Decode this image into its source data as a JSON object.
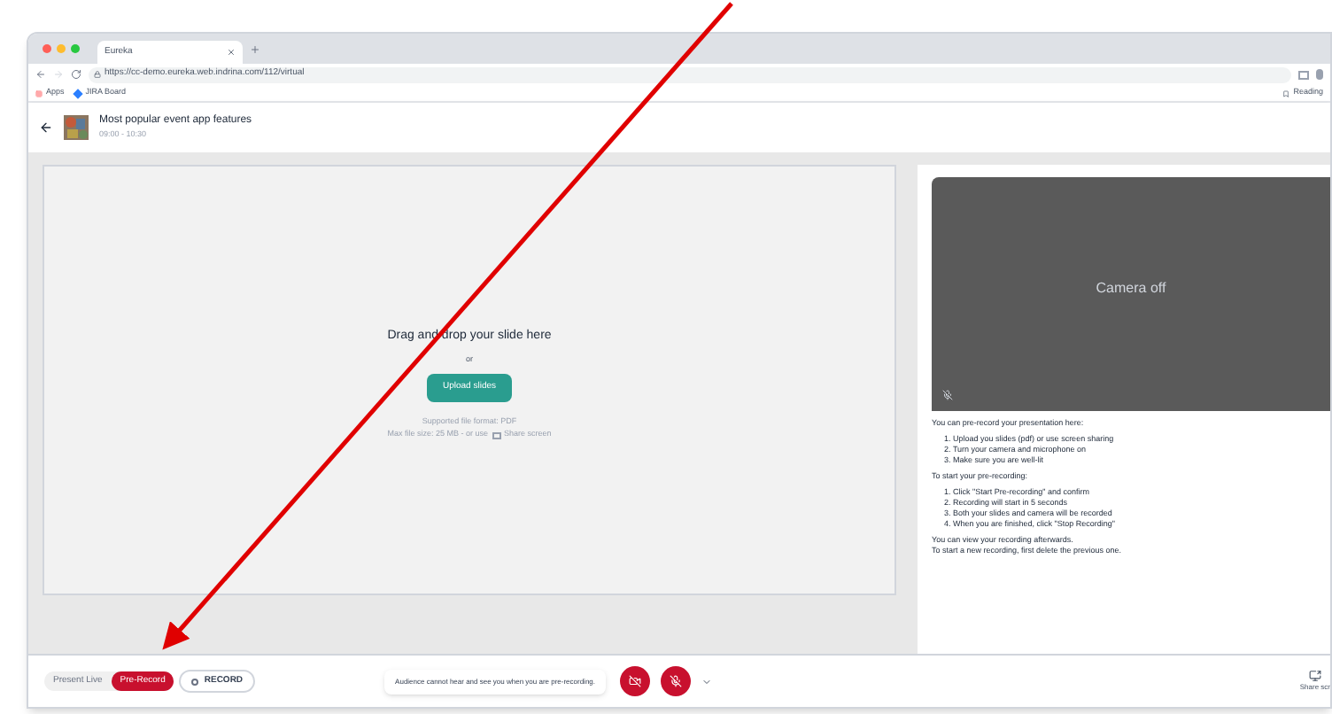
{
  "browser": {
    "tab_title": "Eureka",
    "url": "https://cc-demo.eureka.web.indrina.com/112/virtual",
    "bookmarks": [
      "Apps",
      "JIRA Board"
    ],
    "reading_list": "Reading"
  },
  "session": {
    "title": "Most popular event app features",
    "time": "09:00 - 10:30"
  },
  "upload": {
    "heading": "Drag and drop your slide here",
    "or": "or",
    "button": "Upload slides",
    "format": "Supported file format: PDF",
    "size": "Max file size: 25 MB - or use",
    "share": "Share screen"
  },
  "camera": {
    "label": "Camera off"
  },
  "instructions": {
    "intro": "You can pre-record your presentation here:",
    "prep": [
      {
        "number": "1.",
        "text": "Upload you slides (pdf) or use screen sharing"
      },
      {
        "number": "2.",
        "text": "Turn your camera and microphone on"
      },
      {
        "number": "3.",
        "text": "Make sure you are well-lit"
      }
    ],
    "start_title": "To start your pre-recording:",
    "steps": [
      {
        "number": "1.",
        "text": "Click \"Start Pre-recording\" and confirm"
      },
      {
        "number": "2.",
        "text": "Recording will start in 5 seconds"
      },
      {
        "number": "3.",
        "text": "Both your slides and camera will be recorded"
      },
      {
        "number": "4.",
        "text": "When you are finished, click \"Stop Recording\""
      }
    ],
    "outro": [
      "You can view your recording afterwards.",
      "To start a new recording, first delete the previous one."
    ]
  },
  "modes": [
    {
      "label": "Present Live",
      "selected": false
    },
    {
      "label": "Pre-Record",
      "selected": true
    }
  ],
  "record_button": "RECORD",
  "notice": "Audience cannot hear and see you when you are pre-recording.",
  "share_label": "Share scr"
}
